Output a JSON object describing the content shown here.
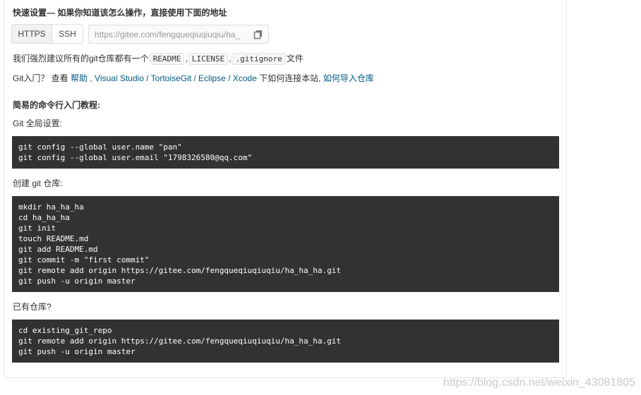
{
  "quick_setup": {
    "title": "快速设置— 如果你知道该怎么操作，直接使用下面的地址",
    "https_label": "HTTPS",
    "ssh_label": "SSH",
    "repo_url": "https://gitee.com/fengqueqiuqiuqiu/ha_"
  },
  "readme_line": {
    "prefix": "我们强烈建议所有的git仓库都有一个",
    "file1": "README",
    "sep1": ",",
    "file2": "LICENSE",
    "sep2": ",",
    "file3": ".gitignore",
    "suffix": "文件"
  },
  "help_line": {
    "prefix": "Git入门？ 查看 ",
    "help": "帮助",
    "sep1": " , ",
    "vs": "Visual Studio",
    "sep2": " / ",
    "tortoise": "TortoiseGit",
    "sep3": " / ",
    "eclipse": "Eclipse",
    "sep4": " / ",
    "xcode": "Xcode",
    "mid": " 下如何连接本站, ",
    "import": "如何导入仓库"
  },
  "tutorial": {
    "title": "简易的命令行入门教程:",
    "global_label": "Git 全局设置:",
    "global_code": "git config --global user.name \"pan\"\ngit config --global user.email \"1798326580@qq.com\"",
    "create_label": "创建 git 仓库:",
    "create_code": "mkdir ha_ha_ha\ncd ha_ha_ha\ngit init\ntouch README.md\ngit add README.md\ngit commit -m \"first commit\"\ngit remote add origin https://gitee.com/fengqueqiuqiuqiu/ha_ha_ha.git\ngit push -u origin master",
    "existing_label": "已有仓库?",
    "existing_code": "cd existing_git_repo\ngit remote add origin https://gitee.com/fengqueqiuqiuqiu/ha_ha_ha.git\ngit push -u origin master"
  },
  "watermark": "https://blog.csdn.net/weixin_43081805",
  "colors": {
    "link": "#005980",
    "code_bg": "#323232",
    "border": "#dcdcdc"
  },
  "icons": {
    "copy": "copy-icon"
  }
}
